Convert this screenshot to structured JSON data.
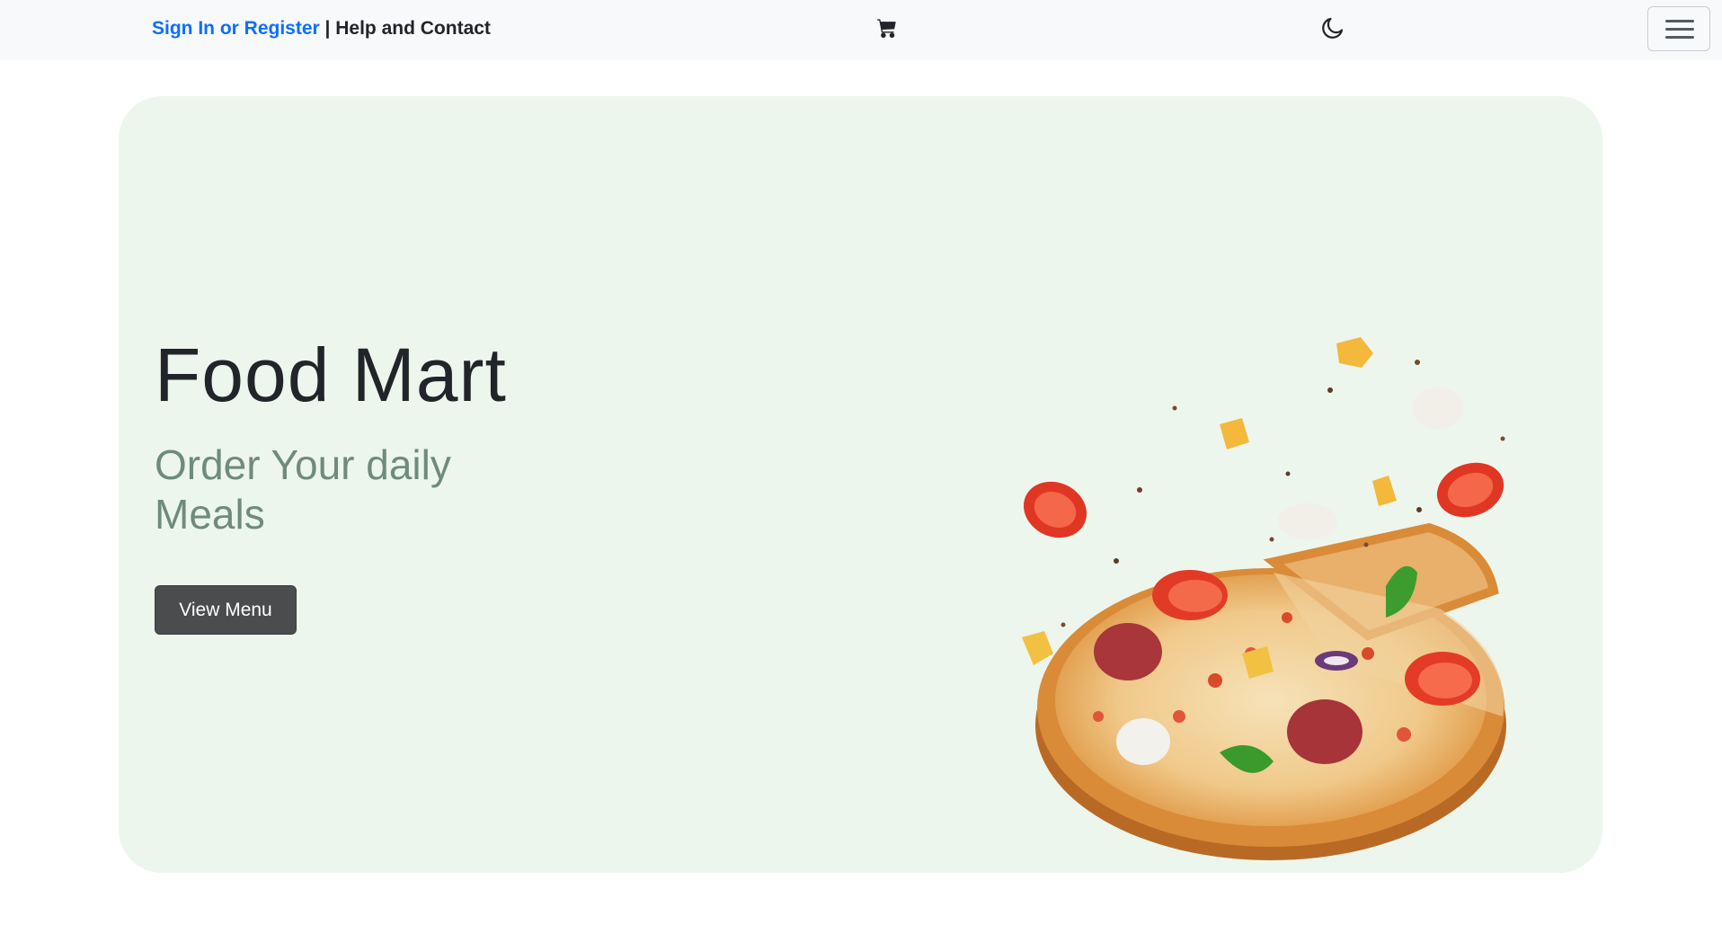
{
  "header": {
    "signin_label": "Sign In or Register",
    "separator": " | ",
    "help_label": "Help and Contact",
    "cart_icon": "cart-icon",
    "theme_icon": "moon-icon",
    "menu_icon": "hamburger-icon"
  },
  "hero": {
    "title": "Food Mart",
    "subtitle": "Order Your daily Meals",
    "cta_label": "View Menu",
    "image": "pizza-with-flying-toppings"
  },
  "colors": {
    "link_blue": "#0d6efd",
    "hero_background": "#edf6ed",
    "subtitle_green": "#6f8b7a",
    "button_dark": "#4a4c4d",
    "header_background": "#f8f9fa"
  }
}
